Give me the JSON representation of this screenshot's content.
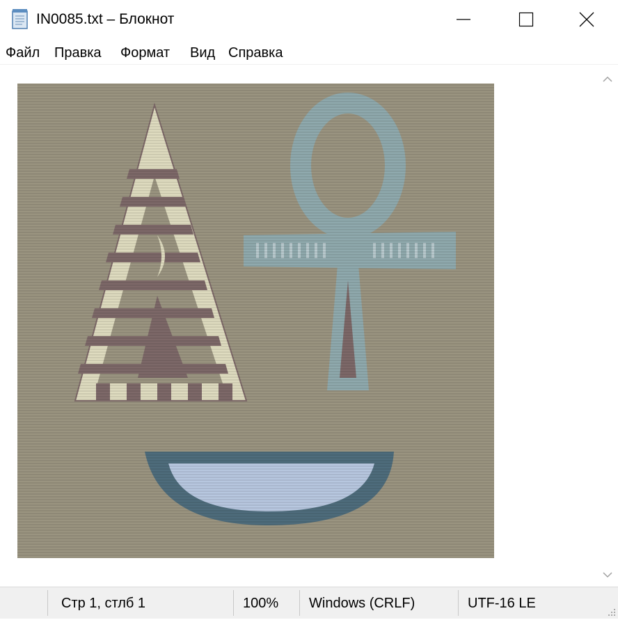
{
  "window": {
    "title": "IN0085.txt – Блокнот",
    "app_icon": "notepad-icon"
  },
  "window_controls": {
    "minimize_icon": "minimize-icon",
    "maximize_icon": "maximize-icon",
    "close_icon": "close-icon"
  },
  "menu": {
    "items": [
      "Файл",
      "Правка",
      "Формат",
      "Вид",
      "Справка"
    ]
  },
  "document": {
    "image_description_icons": [
      "triangle-icon",
      "ankh-icon",
      "bowl-icon"
    ],
    "colors": {
      "background": "#9a9480",
      "stripe_light": "#dedbbf",
      "stripe_dark": "#7d6868",
      "ankh": "#8fa9ad",
      "bowl_outer": "#4e6c7c",
      "bowl_inner": "#b7c7df"
    }
  },
  "scrollbar": {
    "up_icon": "scroll-up-icon",
    "down_icon": "scroll-down-icon"
  },
  "status": {
    "position": "Стр 1, стлб 1",
    "zoom": "100%",
    "line_endings": "Windows (CRLF)",
    "encoding": "UTF-16 LE"
  }
}
